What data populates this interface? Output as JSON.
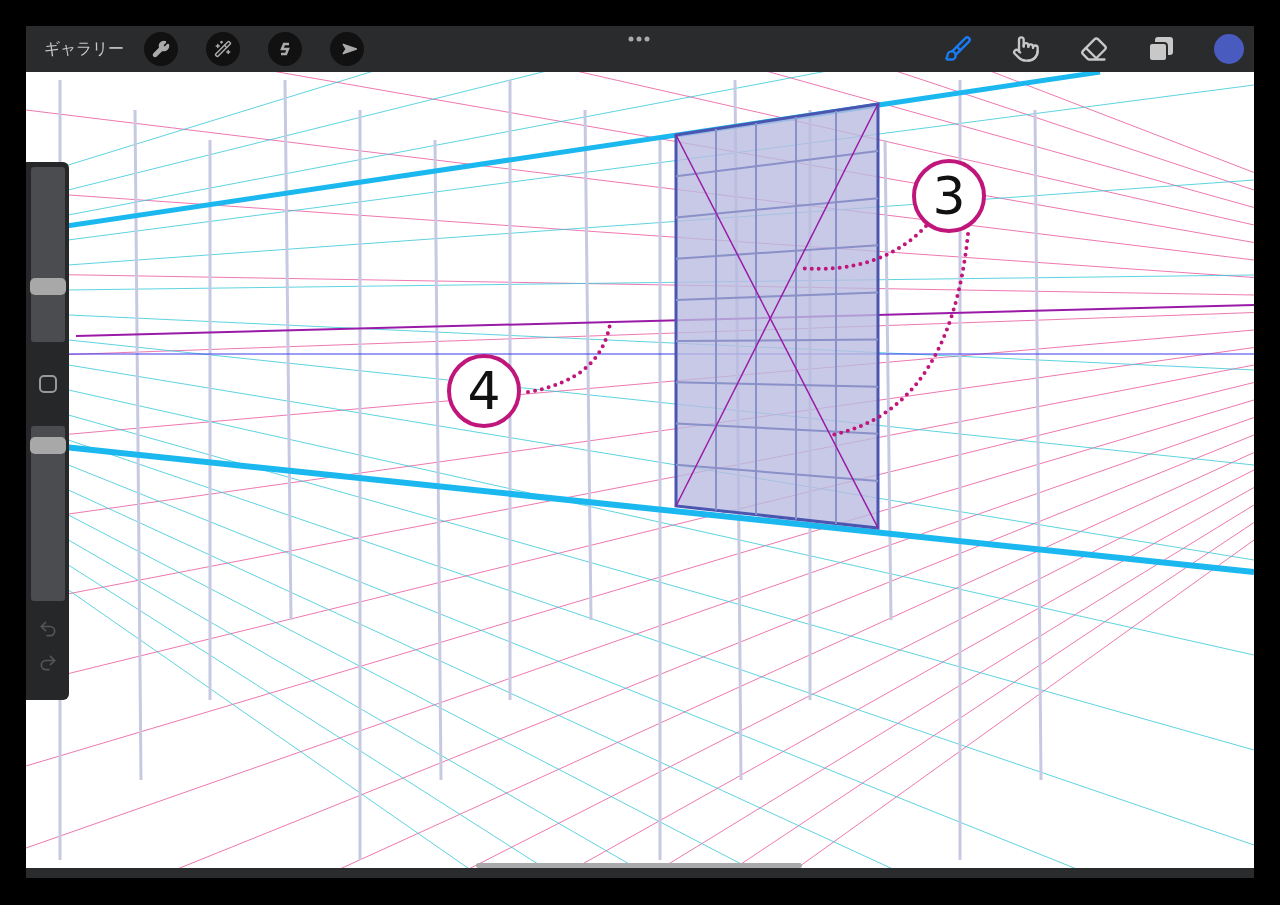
{
  "toolbar": {
    "gallery": "ギャラリー",
    "tools": [
      {
        "kind": "brush",
        "selected": true
      },
      {
        "kind": "smudge",
        "selected": false
      },
      {
        "kind": "eraser",
        "selected": false
      }
    ],
    "color": "#4a5bc0"
  },
  "sidebar": {
    "sliders": [
      {
        "kind": "size",
        "level": 0.3
      },
      {
        "kind": "opacity",
        "level": 0.93
      }
    ]
  },
  "annotations": [
    {
      "label": "3"
    },
    {
      "label": "4"
    }
  ]
}
